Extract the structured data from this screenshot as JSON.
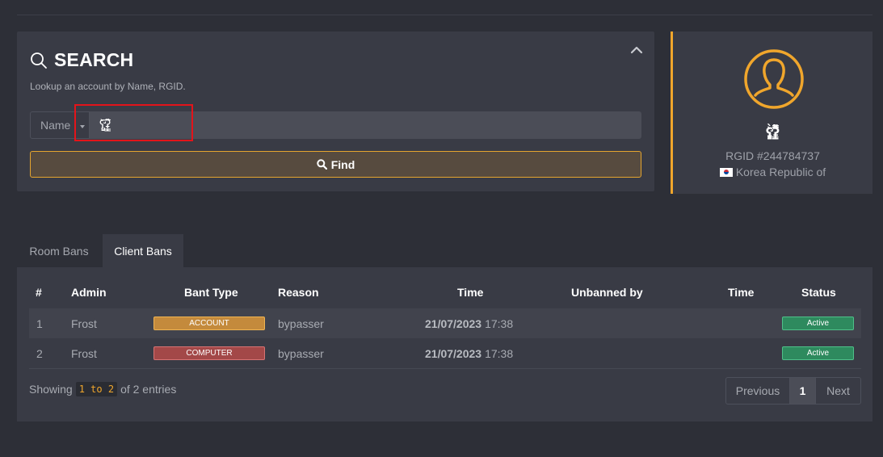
{
  "search": {
    "title": "SEARCH",
    "subtitle": "Lookup an account by Name, RGID.",
    "field_type": "Name",
    "query_value": "ʕ̡̢̡̢̛̛̀̀ʡ̳̳͓̳͓̳̀̀͌̿̿̿͌͌̿͌",
    "find_label": "Find"
  },
  "profile": {
    "name": "ʕ̡̢̡̢̛̛̀̀ʡ̳̳͓̳͓̳̀̀͌̿̿̿͌͌̿͌",
    "rgid": "RGID #244784737",
    "country": "Korea Republic of",
    "accent_color": "#f0a62c"
  },
  "tabs": [
    {
      "label": "Room Bans",
      "active": false
    },
    {
      "label": "Client Bans",
      "active": true
    }
  ],
  "table": {
    "headers": [
      "#",
      "Admin",
      "Bant Type",
      "Reason",
      "Time",
      "Unbanned by",
      "Time",
      "Status"
    ],
    "rows": [
      {
        "num": "1",
        "admin": "Frost",
        "type": "ACCOUNT",
        "reason": "bypasser",
        "date": "21/07/2023",
        "clock": "17:38",
        "unbanned_by": "",
        "unban_time": "",
        "status": "Active"
      },
      {
        "num": "2",
        "admin": "Frost",
        "type": "COMPUTER",
        "reason": "bypasser",
        "date": "21/07/2023",
        "clock": "17:38",
        "unbanned_by": "",
        "unban_time": "",
        "status": "Active"
      }
    ]
  },
  "footer": {
    "showing_prefix": "Showing",
    "showing_range": "1 to 2",
    "showing_suffix": "of 2 entries",
    "previous": "Previous",
    "current_page": "1",
    "next": "Next"
  }
}
